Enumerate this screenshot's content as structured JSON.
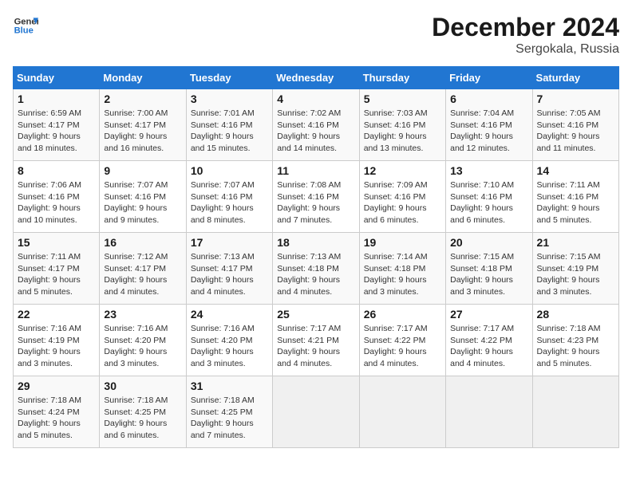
{
  "header": {
    "logo_line1": "General",
    "logo_line2": "Blue",
    "month_title": "December 2024",
    "location": "Sergokala, Russia"
  },
  "days_of_week": [
    "Sunday",
    "Monday",
    "Tuesday",
    "Wednesday",
    "Thursday",
    "Friday",
    "Saturday"
  ],
  "weeks": [
    [
      {
        "day": "1",
        "info": "Sunrise: 6:59 AM\nSunset: 4:17 PM\nDaylight: 9 hours and 18 minutes."
      },
      {
        "day": "2",
        "info": "Sunrise: 7:00 AM\nSunset: 4:17 PM\nDaylight: 9 hours and 16 minutes."
      },
      {
        "day": "3",
        "info": "Sunrise: 7:01 AM\nSunset: 4:16 PM\nDaylight: 9 hours and 15 minutes."
      },
      {
        "day": "4",
        "info": "Sunrise: 7:02 AM\nSunset: 4:16 PM\nDaylight: 9 hours and 14 minutes."
      },
      {
        "day": "5",
        "info": "Sunrise: 7:03 AM\nSunset: 4:16 PM\nDaylight: 9 hours and 13 minutes."
      },
      {
        "day": "6",
        "info": "Sunrise: 7:04 AM\nSunset: 4:16 PM\nDaylight: 9 hours and 12 minutes."
      },
      {
        "day": "7",
        "info": "Sunrise: 7:05 AM\nSunset: 4:16 PM\nDaylight: 9 hours and 11 minutes."
      }
    ],
    [
      {
        "day": "8",
        "info": "Sunrise: 7:06 AM\nSunset: 4:16 PM\nDaylight: 9 hours and 10 minutes."
      },
      {
        "day": "9",
        "info": "Sunrise: 7:07 AM\nSunset: 4:16 PM\nDaylight: 9 hours and 9 minutes."
      },
      {
        "day": "10",
        "info": "Sunrise: 7:07 AM\nSunset: 4:16 PM\nDaylight: 9 hours and 8 minutes."
      },
      {
        "day": "11",
        "info": "Sunrise: 7:08 AM\nSunset: 4:16 PM\nDaylight: 9 hours and 7 minutes."
      },
      {
        "day": "12",
        "info": "Sunrise: 7:09 AM\nSunset: 4:16 PM\nDaylight: 9 hours and 6 minutes."
      },
      {
        "day": "13",
        "info": "Sunrise: 7:10 AM\nSunset: 4:16 PM\nDaylight: 9 hours and 6 minutes."
      },
      {
        "day": "14",
        "info": "Sunrise: 7:11 AM\nSunset: 4:16 PM\nDaylight: 9 hours and 5 minutes."
      }
    ],
    [
      {
        "day": "15",
        "info": "Sunrise: 7:11 AM\nSunset: 4:17 PM\nDaylight: 9 hours and 5 minutes."
      },
      {
        "day": "16",
        "info": "Sunrise: 7:12 AM\nSunset: 4:17 PM\nDaylight: 9 hours and 4 minutes."
      },
      {
        "day": "17",
        "info": "Sunrise: 7:13 AM\nSunset: 4:17 PM\nDaylight: 9 hours and 4 minutes."
      },
      {
        "day": "18",
        "info": "Sunrise: 7:13 AM\nSunset: 4:18 PM\nDaylight: 9 hours and 4 minutes."
      },
      {
        "day": "19",
        "info": "Sunrise: 7:14 AM\nSunset: 4:18 PM\nDaylight: 9 hours and 3 minutes."
      },
      {
        "day": "20",
        "info": "Sunrise: 7:15 AM\nSunset: 4:18 PM\nDaylight: 9 hours and 3 minutes."
      },
      {
        "day": "21",
        "info": "Sunrise: 7:15 AM\nSunset: 4:19 PM\nDaylight: 9 hours and 3 minutes."
      }
    ],
    [
      {
        "day": "22",
        "info": "Sunrise: 7:16 AM\nSunset: 4:19 PM\nDaylight: 9 hours and 3 minutes."
      },
      {
        "day": "23",
        "info": "Sunrise: 7:16 AM\nSunset: 4:20 PM\nDaylight: 9 hours and 3 minutes."
      },
      {
        "day": "24",
        "info": "Sunrise: 7:16 AM\nSunset: 4:20 PM\nDaylight: 9 hours and 3 minutes."
      },
      {
        "day": "25",
        "info": "Sunrise: 7:17 AM\nSunset: 4:21 PM\nDaylight: 9 hours and 4 minutes."
      },
      {
        "day": "26",
        "info": "Sunrise: 7:17 AM\nSunset: 4:22 PM\nDaylight: 9 hours and 4 minutes."
      },
      {
        "day": "27",
        "info": "Sunrise: 7:17 AM\nSunset: 4:22 PM\nDaylight: 9 hours and 4 minutes."
      },
      {
        "day": "28",
        "info": "Sunrise: 7:18 AM\nSunset: 4:23 PM\nDaylight: 9 hours and 5 minutes."
      }
    ],
    [
      {
        "day": "29",
        "info": "Sunrise: 7:18 AM\nSunset: 4:24 PM\nDaylight: 9 hours and 5 minutes."
      },
      {
        "day": "30",
        "info": "Sunrise: 7:18 AM\nSunset: 4:25 PM\nDaylight: 9 hours and 6 minutes."
      },
      {
        "day": "31",
        "info": "Sunrise: 7:18 AM\nSunset: 4:25 PM\nDaylight: 9 hours and 7 minutes."
      },
      {
        "day": "",
        "info": ""
      },
      {
        "day": "",
        "info": ""
      },
      {
        "day": "",
        "info": ""
      },
      {
        "day": "",
        "info": ""
      }
    ]
  ]
}
